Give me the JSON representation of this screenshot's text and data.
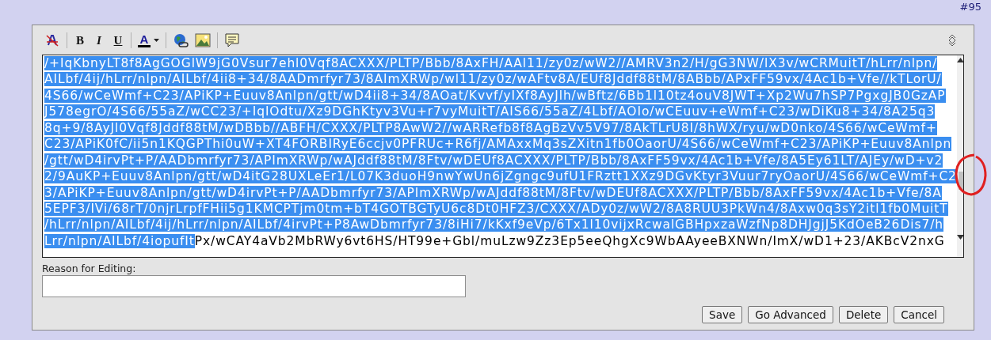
{
  "post_number": "#95",
  "toolbar": [
    {
      "kind": "clear"
    },
    {
      "kind": "bold",
      "label": "B"
    },
    {
      "kind": "italic",
      "label": "I"
    },
    {
      "kind": "underline",
      "label": "U"
    },
    {
      "kind": "color",
      "label": "A",
      "color": "#000000"
    },
    {
      "kind": "link"
    },
    {
      "kind": "image"
    },
    {
      "kind": "quote"
    }
  ],
  "editor": {
    "lines": [
      {
        "segments": [
          {
            "text": "/+IqKbnyLT8f8AgGOGlW9jG0Vsur7ehl0Vqf8ACXXX/PLTP/Bbb/8AxFH/AAl11/zy0z/wW2//AMRV3n2/H/gG3NW/lX3v/wCRMuitT/hLrr/nlpn/",
            "selected": true
          }
        ]
      },
      {
        "segments": [
          {
            "text": "AILbf/4ij/hLrr/nlpn/AILbf/4ii8+34/8AADmrfyr73/8AImXRWp/wl11/zy0z/wAFtv8A/EUf8Jddf88tM/8ABbb/APxFF59vx/4Ac1b+Vfe//kTLorU/",
            "selected": true
          }
        ]
      },
      {
        "segments": [
          {
            "text": "4S66/wCeWmf+C23/APiKP+Euuv8Anlpn/gtt/wD4ii8+34/8AOat/Kvvf/yIXf8AyJlh/wBftz/6Bb1l10tz4ouV8JWT+Xp2Wu7hSP7PgxgJB0GzAP",
            "selected": true
          }
        ]
      },
      {
        "segments": [
          {
            "text": "J578egrO/4S66/55aZ/wCC23/+IqIOdtu/Xz9DGhKtyv3Vu+r7vyMuitT/AIS66/55aZ/4Lbf/AOIo/wCEuuv+eWmf+C23/wDiKu8+34/8A25q3",
            "selected": true
          }
        ]
      },
      {
        "segments": [
          {
            "text": "8q+9/8AyJl0Vqf8Jddf88tM/wDBbb//ABFH/CXXX/PLTP8AwW2//wARRefb8f8AgBzVv5V97/8AkTLrU8I/8hWX/ryu/wD0nko/4S66/wCeWmf+",
            "selected": true
          }
        ]
      },
      {
        "segments": [
          {
            "text": "C23/APiK0fC/ii5n1KQGPThi0uW+XT4FORBIRyE6ccjv0PFRUc+R6fj/AMAxxMq3sZXitn1fb0OaorU/4S66/wCeWmf+C23/APiKP+Euuv8Anlpn",
            "selected": true
          }
        ]
      },
      {
        "segments": [
          {
            "text": "/gtt/wD4irvPt+P/AADbmrfyr73/APImXRWp/wAJddf88tM/8Ftv/wDEUf8ACXXX/PLTP/Bbb/8AxFF59vx/4Ac1b+Vfe/8A5Ey61LT/AJEy/wD+v2",
            "selected": true
          }
        ]
      },
      {
        "segments": [
          {
            "text": "2/9AuKP+Euuv8Anlpn/gtt/wD4itG28UXLeEr1/L07K3duoH9nwYwUn6jZgngc9ufU1FRztt1XXz9DGvKtyr3Vuur7ryOaorU/4S66/wCeWmf+C2",
            "selected": true
          }
        ]
      },
      {
        "segments": [
          {
            "text": "3/APiKP+Euuv8Anlpn/gtt/wD4irvPt+P/AADbmrfyr73/APImXRWp/wAJddf88tM/8Ftv/wDEUf8ACXXX/PLTP/Bbb/8AxFF59vx/4Ac1b+Vfe/8A",
            "selected": true
          }
        ]
      },
      {
        "segments": [
          {
            "text": "5EPF3/IVi/68rT/0njrLrpfFHii5g1KMCPTjm0tm+bT4GOTBGTyU6c8Dt0HFZ3/CXXX/ADy0z/wW2/8A8RUU3PkWn4/8Axw0q3sY2itl1fb0MuitT",
            "selected": true
          }
        ]
      },
      {
        "segments": [
          {
            "text": "/hLrr/nlpn/AILbf/4ij/hLrr/nlpn/AILbf/4irvPt+P8AwDbmrfyr73/8iHi7/kKxf9eVp/6Tx1l10vijxRcwalGBHpxzaWzfNp8DHJgjJ5KdOeB26Dis7/h",
            "selected": true
          }
        ]
      },
      {
        "segments": [
          {
            "text": "Lrr/nlpn/AILbf/4iopufIt",
            "selected": true
          },
          {
            "text": "Px/wCAY4aVb2MbRWy6vt6HS/HT99e+Gbl/muLzw9Zz3Ep5eeQhgXc9WbAAyeeBXNWn/ImX/wD1+23/AKBcV2nxG",
            "selected": false
          }
        ]
      }
    ]
  },
  "reason": {
    "label": "Reason for Editing:"
  },
  "buttons": [
    "Save",
    "Go Advanced",
    "Delete",
    "Cancel"
  ]
}
